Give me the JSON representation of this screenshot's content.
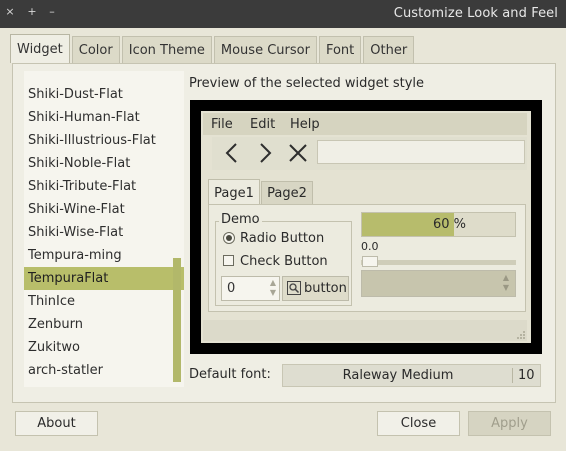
{
  "window": {
    "title": "Customize Look and Feel",
    "buttons": [
      "×",
      "+",
      "–"
    ]
  },
  "tabs": [
    "Widget",
    "Color",
    "Icon Theme",
    "Mouse Cursor",
    "Font",
    "Other"
  ],
  "active_tab": "Widget",
  "theme_list": {
    "items": [
      "Shiki-Dust-Flat",
      "Shiki-Human-Flat",
      "Shiki-Illustrious-Flat",
      "Shiki-Noble-Flat",
      "Shiki-Tribute-Flat",
      "Shiki-Wine-Flat",
      "Shiki-Wise-Flat",
      "Tempura-ming",
      "TempuraFlat",
      "ThinIce",
      "Zenburn",
      "Zukitwo",
      "arch-statler"
    ],
    "selected": "TempuraFlat"
  },
  "preview": {
    "label": "Preview of the selected widget style",
    "menu": [
      "File",
      "Edit",
      "Help"
    ],
    "toolbar_icons": [
      "back-arrow",
      "forward-arrow",
      "close-x"
    ],
    "tabs": [
      "Page1",
      "Page2"
    ],
    "demo": {
      "legend": "Demo",
      "radio_label": "Radio Button",
      "check_label": "Check Button",
      "spin_value": "0",
      "button_label": "button"
    },
    "progress": {
      "fraction": 0.6,
      "text": "60 %"
    },
    "scale_value": "0.0"
  },
  "font": {
    "label": "Default font:",
    "name": "Raleway Medium",
    "size": "10"
  },
  "buttons": {
    "about": "About",
    "close": "Close",
    "apply": "Apply"
  },
  "colors": {
    "accent": "#b8be6a",
    "titlebar": "#3b3b3b",
    "background": "#e8e6d8"
  }
}
